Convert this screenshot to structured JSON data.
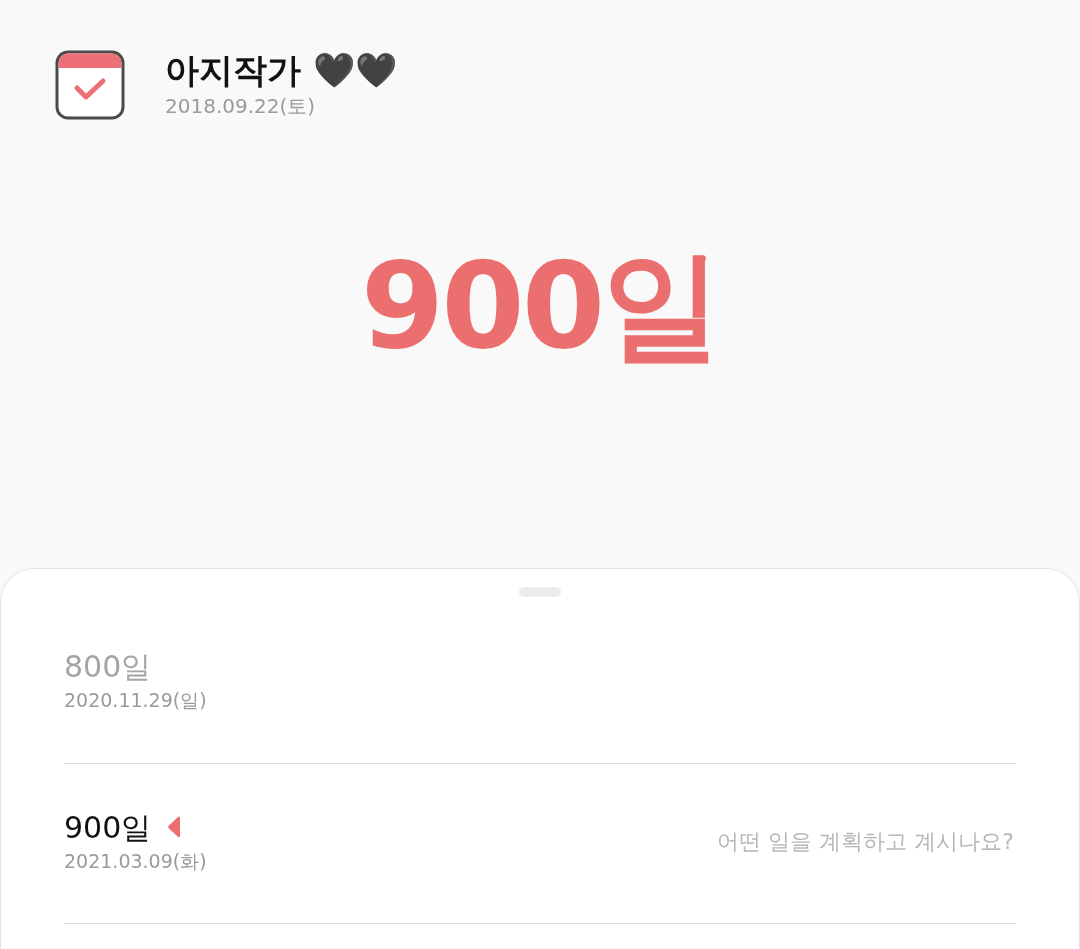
{
  "header": {
    "title": "아지작가 🖤🖤",
    "date": "2018.09.22(토)"
  },
  "hero": {
    "count": "900일"
  },
  "milestones": [
    {
      "label": "800일",
      "date": "2020.11.29(일)",
      "passed": true,
      "current": false
    },
    {
      "label": "900일",
      "date": "2021.03.09(화)",
      "passed": false,
      "current": true,
      "placeholder": "어떤 일을 계획하고 계시나요?"
    }
  ]
}
